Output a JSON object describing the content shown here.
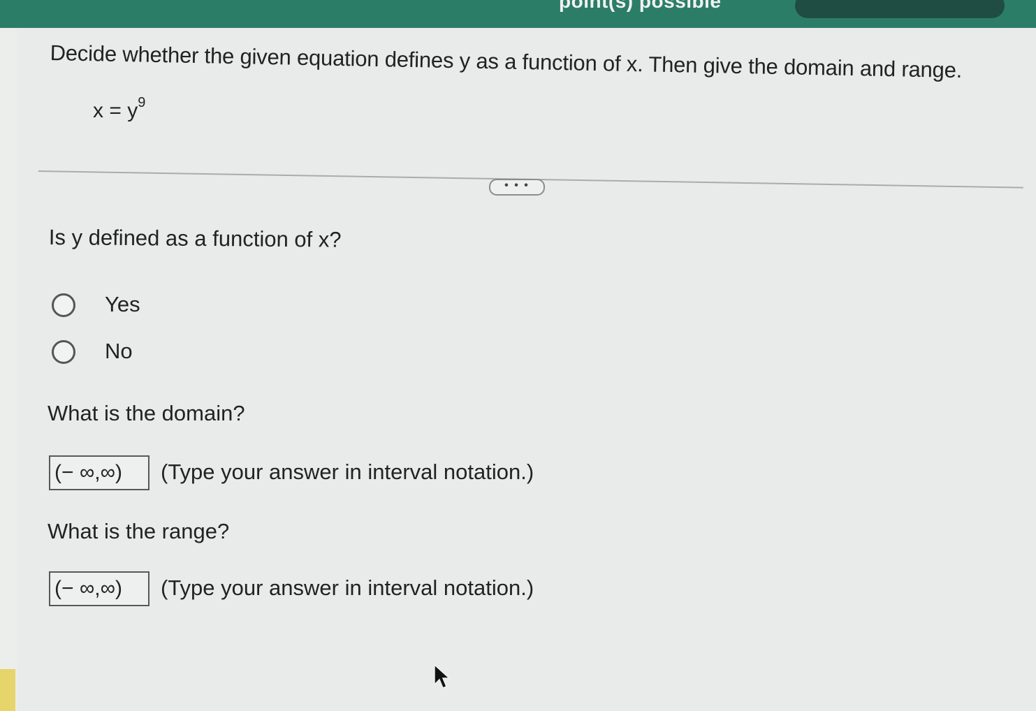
{
  "header": {
    "points_label": "point(s) possible"
  },
  "question": {
    "text": "Decide whether the given equation defines y as a function of x. Then give the domain and range.",
    "equation_lhs": "x = y",
    "equation_exponent": "9"
  },
  "more_button_label": "• • •",
  "function_part": {
    "prompt": "Is y defined as a function of x?",
    "options": [
      {
        "label": "Yes",
        "selected": false
      },
      {
        "label": "No",
        "selected": false
      }
    ]
  },
  "domain_part": {
    "prompt": "What is the domain?",
    "answer": "(− ∞,∞)",
    "hint": "(Type your answer in interval notation.)"
  },
  "range_part": {
    "prompt": "What is the range?",
    "answer": "(− ∞,∞)",
    "hint": "(Type your answer in interval notation.)"
  },
  "colors": {
    "header_bar": "#2c7d68",
    "background": "#e9ebea",
    "text": "#222222"
  }
}
